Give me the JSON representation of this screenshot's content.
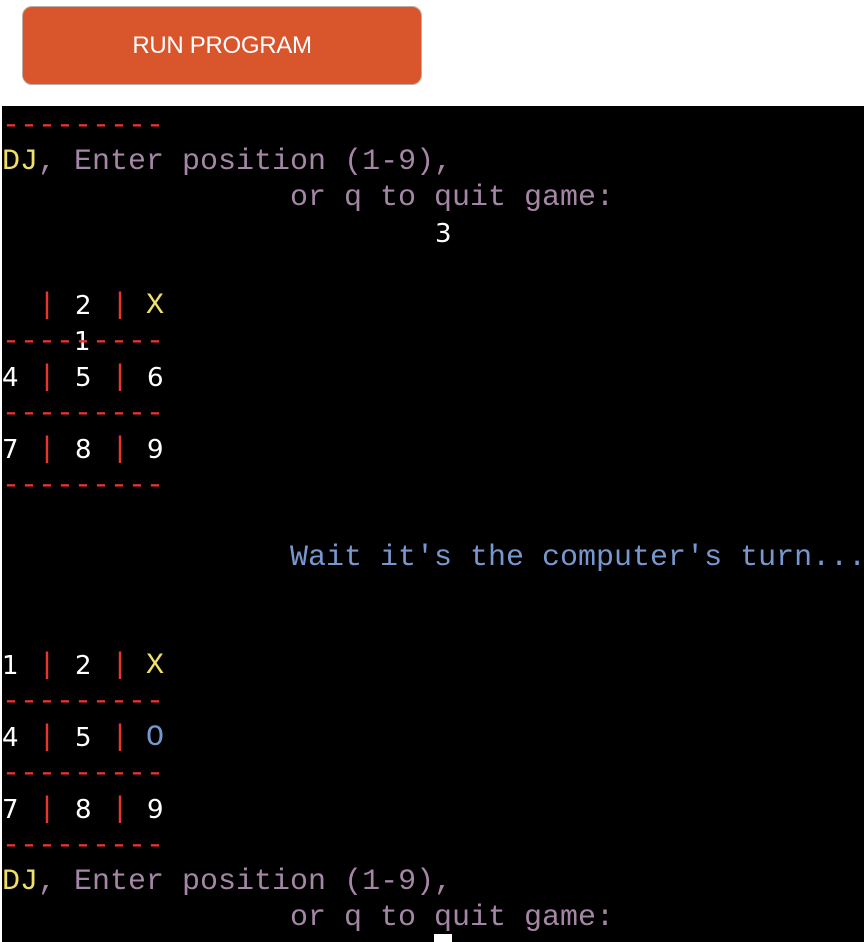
{
  "run_button": {
    "label": "RUN PROGRAM"
  },
  "colors": {
    "button": "#d9552b",
    "terminal_bg": "#000000",
    "name": "#efe06a",
    "prompt": "#a586a6",
    "message": "#7798cf",
    "separator": "#e8352f",
    "cell": "#ffffff"
  },
  "terminal": {
    "separator": "---------",
    "pipe": "|",
    "player_name": "DJ",
    "prompt_line1": ", Enter position (1-9),",
    "prompt_line2": "or q to quit game:",
    "user_input": "3",
    "wait_message": "Wait it's the computer's turn...",
    "board1": [
      [
        "1",
        "2",
        "X"
      ],
      [
        "4",
        "5",
        "6"
      ],
      [
        "7",
        "8",
        "9"
      ]
    ],
    "board2": [
      [
        "1",
        "2",
        "X"
      ],
      [
        "4",
        "5",
        "O"
      ],
      [
        "7",
        "8",
        "9"
      ]
    ]
  }
}
